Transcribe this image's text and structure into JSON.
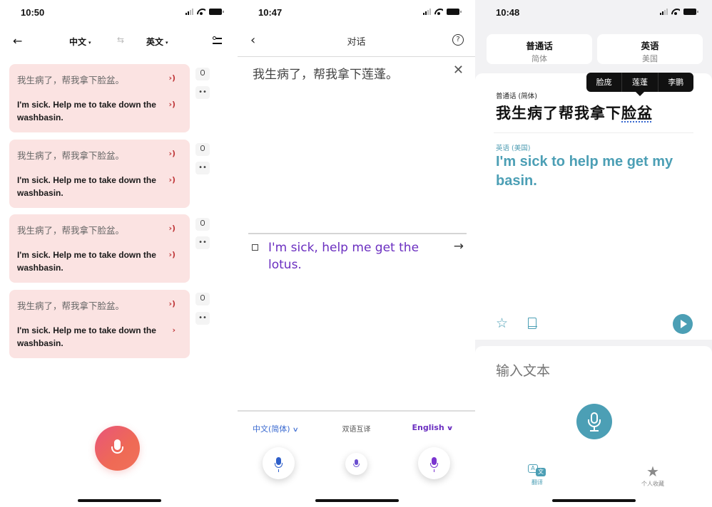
{
  "panel1": {
    "status_time": "10:50",
    "nav": {
      "back_icon": "back-arrow-icon",
      "source_lang": "中文",
      "target_lang": "英文",
      "caret": "▾",
      "swap_icon": "⇆",
      "settings_icon": "settings-icon"
    },
    "cards": [
      {
        "zh": "我生病了，帮我拿下脸盆。",
        "en": "I'm sick. Help me to take down the washbasin.",
        "zh_speaker": "›)",
        "en_speaker": "›)"
      },
      {
        "zh": "我生病了，帮我拿下脸盆。",
        "en": "I'm sick. Help me to take down the washbasin.",
        "zh_speaker": "›)",
        "en_speaker": "›)"
      },
      {
        "zh": "我生病了，帮我拿下脸盆。",
        "en": "I'm sick. Help me to take down the washbasin.",
        "zh_speaker": "›)",
        "en_speaker": "›)"
      },
      {
        "zh": "我生病了，帮我拿下脸盆。",
        "en": "I'm sick. Help me to take down the washbasin.",
        "zh_speaker": "›)",
        "en_speaker": "›"
      }
    ],
    "side_more": "••",
    "colors": {
      "card_bg": "#fbe3e2",
      "accent": "#ef6a55",
      "speaker": "#c0393b"
    }
  },
  "panel2": {
    "status_time": "10:47",
    "title": "对话",
    "back": "‹",
    "help": "?",
    "source_text": "我生病了，帮我拿下莲蓬。",
    "close": "✕",
    "target_text": "I'm sick, help me get the lotus.",
    "arrow": "→",
    "lang_left": "中文(简体)",
    "lang_middle": "双语互译",
    "lang_right": "English",
    "chevron": "⌄",
    "colors": {
      "source_lang": "#3a6ad0",
      "target_lang": "#6b2fc0"
    }
  },
  "panel3": {
    "status_time": "10:48",
    "seg_left": {
      "title": "普通话",
      "sub": "简体"
    },
    "seg_right": {
      "title": "英语",
      "sub": "美国"
    },
    "popup": [
      "脸庞",
      "莲蓬",
      "李鹏"
    ],
    "source_label": "普通话 (简体)",
    "source_text_main": "我生病了帮我拿下",
    "source_text_highlight": "脸盆",
    "target_label": "英语 (美国)",
    "target_text": "I'm sick to help me get my basin.",
    "star": "☆",
    "input_placeholder": "输入文本",
    "tabs": [
      {
        "label": "翻译",
        "icon_a": "A",
        "icon_b": "文"
      },
      {
        "label": "个人收藏",
        "icon": "★"
      }
    ],
    "colors": {
      "accent": "#4c9fb5"
    }
  }
}
